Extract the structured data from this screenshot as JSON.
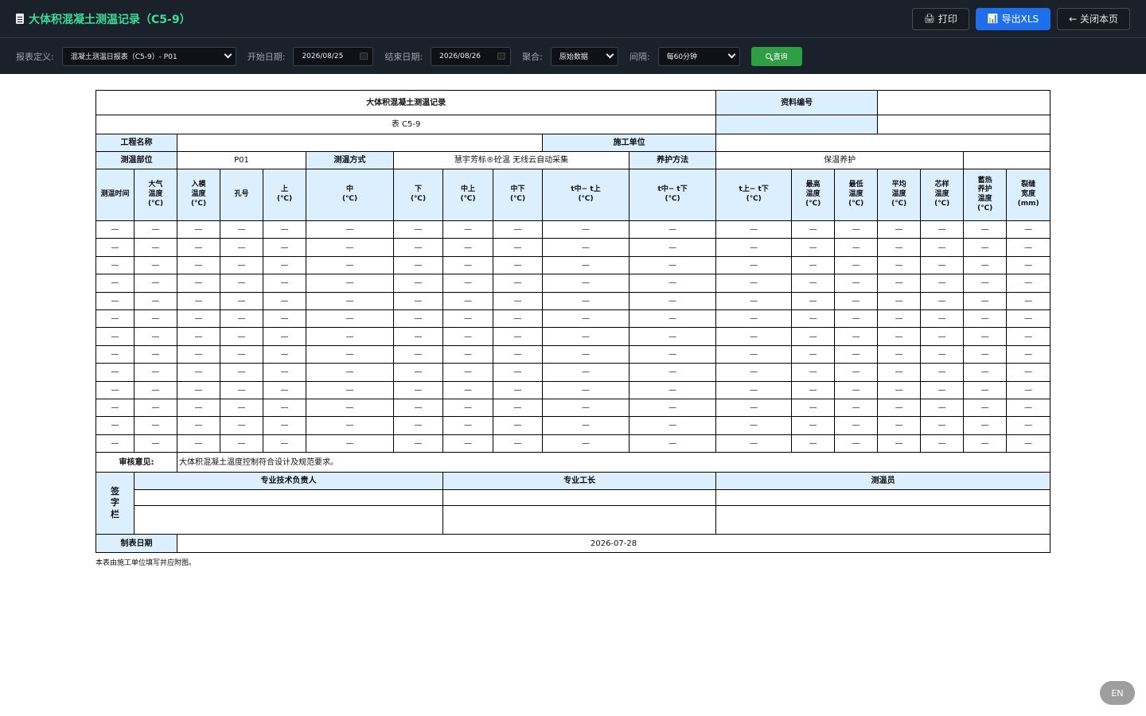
{
  "titlebar": {
    "title": "大体积混凝土测温记录（C5-9）",
    "print_label": "打印",
    "export_label": "导出XLS",
    "close_label": "← 关闭本页"
  },
  "filters": {
    "report_def_label": "报表定义:",
    "report_def_value": "混凝土测温日报表（C5-9）- P01",
    "start_label": "开始日期:",
    "start_value": "2026/08/25",
    "end_label": "结束日期:",
    "end_value": "2026/08/26",
    "agg_label": "聚合:",
    "agg_value": "原始数据",
    "interval_label": "间隔:",
    "interval_value": "每60分钟",
    "query_label": "查询"
  },
  "report": {
    "title": "大体积混凝土测温记录",
    "doc_no_label": "资料编号",
    "doc_no_value": "",
    "form_code": "表 C5-9",
    "project_name_label": "工程名称",
    "project_name_value": "",
    "contractor_label": "施工单位",
    "contractor_value": "",
    "location_label": "测温部位",
    "location_value": "P01",
    "method_label": "测温方式",
    "method_value": "慧宇芳标®砼温 无线云自动采集",
    "curing_label": "养护方法",
    "curing_value": "保温养护",
    "columns": [
      "测温时间",
      "大气\n温度\n(℃)",
      "入模\n温度\n(℃)",
      "孔号",
      "上\n(℃)",
      "中\n(℃)",
      "下\n(℃)",
      "中上\n(℃)",
      "中下\n(℃)",
      "t中− t上\n(℃)",
      "t中− t下\n(℃)",
      "t上− t下\n(℃)",
      "最高\n温度\n(℃)",
      "最低\n温度\n(℃)",
      "平均\n温度\n(℃)",
      "芯样\n温度\n(℃)",
      "蓄热\n养护\n温度\n(℃)",
      "裂缝\n宽度\n(mm)"
    ],
    "empty_cell": "—",
    "row_count": 13,
    "review_label": "审核意见:",
    "review_value": "大体积混凝土温度控制符合设计及规范要求。",
    "sign_label": "签\n字\n栏",
    "sign_roles": [
      "专业技术负责人",
      "专业工长",
      "测温员"
    ],
    "date_label": "制表日期",
    "date_value": "2026-07-28",
    "footnote": "本表由施工单位填写并应附图。"
  },
  "lang_button": "EN",
  "colors": {
    "bar_bg": "#1b212b",
    "title_green": "#3ddc97",
    "export_blue": "#1f6feb",
    "query_green": "#2ea043",
    "header_cell": "#dcefff"
  }
}
